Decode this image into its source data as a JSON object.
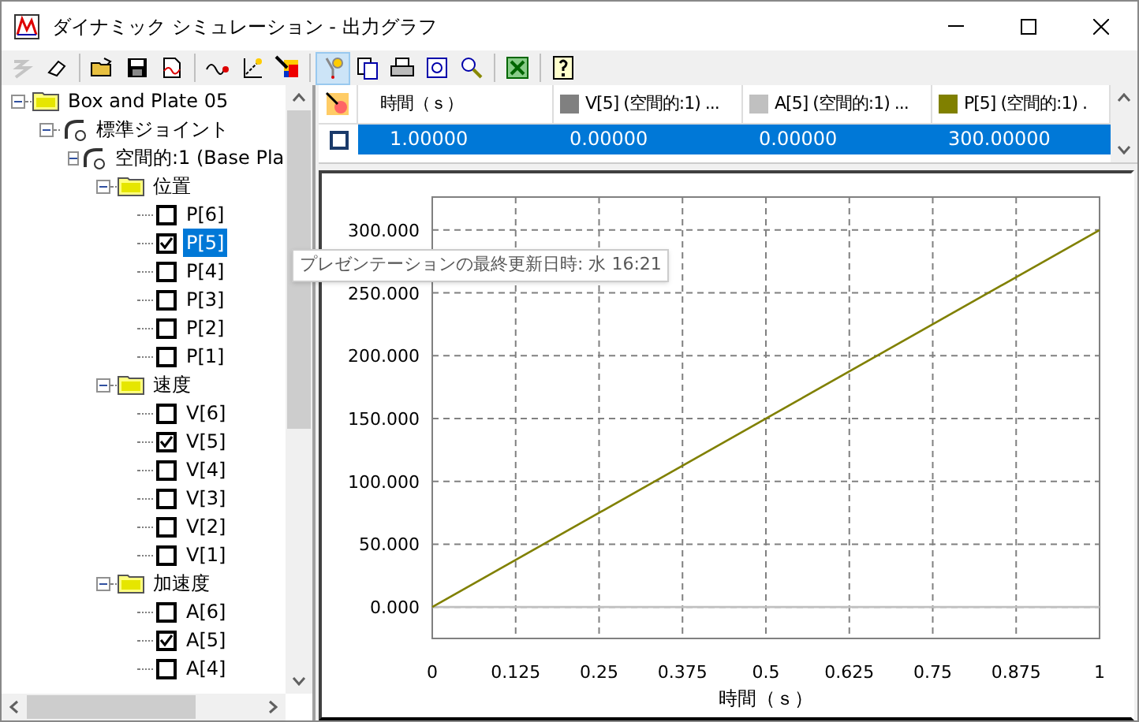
{
  "window": {
    "title": "ダイナミック シミュレーション - 出力グラフ"
  },
  "toolbar": [
    [
      {
        "selected": false,
        "disabled": true
      },
      {
        "selected": false,
        "disabled": false
      }
    ],
    [
      {
        "selected": false,
        "disabled": false
      },
      {
        "selected": false,
        "disabled": false
      },
      {
        "selected": false,
        "disabled": false
      }
    ],
    [
      {
        "selected": false,
        "disabled": false
      },
      {
        "selected": false,
        "disabled": false
      },
      {
        "selected": false,
        "disabled": false
      }
    ],
    [
      {
        "selected": true,
        "disabled": false
      },
      {
        "selected": false,
        "disabled": false
      },
      {
        "selected": false,
        "disabled": false
      },
      {
        "selected": false,
        "disabled": false
      },
      {
        "selected": false,
        "disabled": false
      }
    ],
    [
      {
        "selected": false,
        "disabled": false
      }
    ],
    [
      {
        "selected": false,
        "disabled": false
      }
    ]
  ],
  "tree": [
    {
      "label": "Box and Plate 05",
      "kind": "folder",
      "expanded": true,
      "children": [
        {
          "label": "標準ジョイント",
          "kind": "joint",
          "expanded": true,
          "children": [
            {
              "label": "空間的:1 (Base Pla",
              "kind": "joint",
              "expanded": true,
              "children": [
                {
                  "label": "位置",
                  "kind": "folder",
                  "expanded": true,
                  "children": [
                    {
                      "label": "P[6]",
                      "kind": "check",
                      "checked": false,
                      "selected": false
                    },
                    {
                      "label": "P[5]",
                      "kind": "check",
                      "checked": true,
                      "selected": true
                    },
                    {
                      "label": "P[4]",
                      "kind": "check",
                      "checked": false,
                      "selected": false
                    },
                    {
                      "label": "P[3]",
                      "kind": "check",
                      "checked": false,
                      "selected": false
                    },
                    {
                      "label": "P[2]",
                      "kind": "check",
                      "checked": false,
                      "selected": false
                    },
                    {
                      "label": "P[1]",
                      "kind": "check",
                      "checked": false,
                      "selected": false
                    }
                  ]
                },
                {
                  "label": "速度",
                  "kind": "folder",
                  "expanded": true,
                  "children": [
                    {
                      "label": "V[6]",
                      "kind": "check",
                      "checked": false,
                      "selected": false
                    },
                    {
                      "label": "V[5]",
                      "kind": "check",
                      "checked": true,
                      "selected": false
                    },
                    {
                      "label": "V[4]",
                      "kind": "check",
                      "checked": false,
                      "selected": false
                    },
                    {
                      "label": "V[3]",
                      "kind": "check",
                      "checked": false,
                      "selected": false
                    },
                    {
                      "label": "V[2]",
                      "kind": "check",
                      "checked": false,
                      "selected": false
                    },
                    {
                      "label": "V[1]",
                      "kind": "check",
                      "checked": false,
                      "selected": false
                    }
                  ]
                },
                {
                  "label": "加速度",
                  "kind": "folder",
                  "expanded": true,
                  "children": [
                    {
                      "label": "A[6]",
                      "kind": "check",
                      "checked": false,
                      "selected": false
                    },
                    {
                      "label": "A[5]",
                      "kind": "check",
                      "checked": true,
                      "selected": false
                    },
                    {
                      "label": "A[4]",
                      "kind": "check",
                      "checked": false,
                      "selected": false
                    }
                  ]
                }
              ]
            }
          ]
        }
      ]
    }
  ],
  "tooltip": "プレゼンテーションの最終更新日時: 水 16:21",
  "table": {
    "columns": [
      {
        "label": "時間（ｓ）"
      },
      {
        "label": "V[5] (空間的:1) ...",
        "color": "#808080"
      },
      {
        "label": "A[5] (空間的:1) ...",
        "color": "#c0c0c0"
      },
      {
        "label": "P[5] (空間的:1) .",
        "color": "#808000"
      }
    ],
    "rows": [
      {
        "checked": false,
        "selected": true,
        "cells": [
          "1.00000",
          "0.00000",
          "0.00000",
          "300.00000"
        ]
      }
    ]
  },
  "chart": {
    "chart_data": {
      "type": "line",
      "xlabel": "時間（ｓ）",
      "x": [
        0,
        1
      ],
      "xlim": [
        0,
        1
      ],
      "ylim": [
        -25,
        326.25
      ],
      "xticks": [
        0,
        0.125,
        0.25,
        0.375,
        0.5,
        0.625,
        0.75,
        0.875,
        1
      ],
      "yticks": [
        {
          "value": 0,
          "label": "0.000"
        },
        {
          "value": 50,
          "label": "50.000"
        },
        {
          "value": 100,
          "label": "100.000"
        },
        {
          "value": 150,
          "label": "150.000"
        },
        {
          "value": 200,
          "label": "200.000"
        },
        {
          "value": 250,
          "label": "250.000"
        },
        {
          "value": 300,
          "label": "300.000"
        }
      ],
      "series": [
        {
          "color": "#c0c0c0",
          "values": [
            0,
            0
          ]
        },
        {
          "color": "#808000",
          "values": [
            0,
            300
          ]
        }
      ],
      "grid": true
    }
  }
}
